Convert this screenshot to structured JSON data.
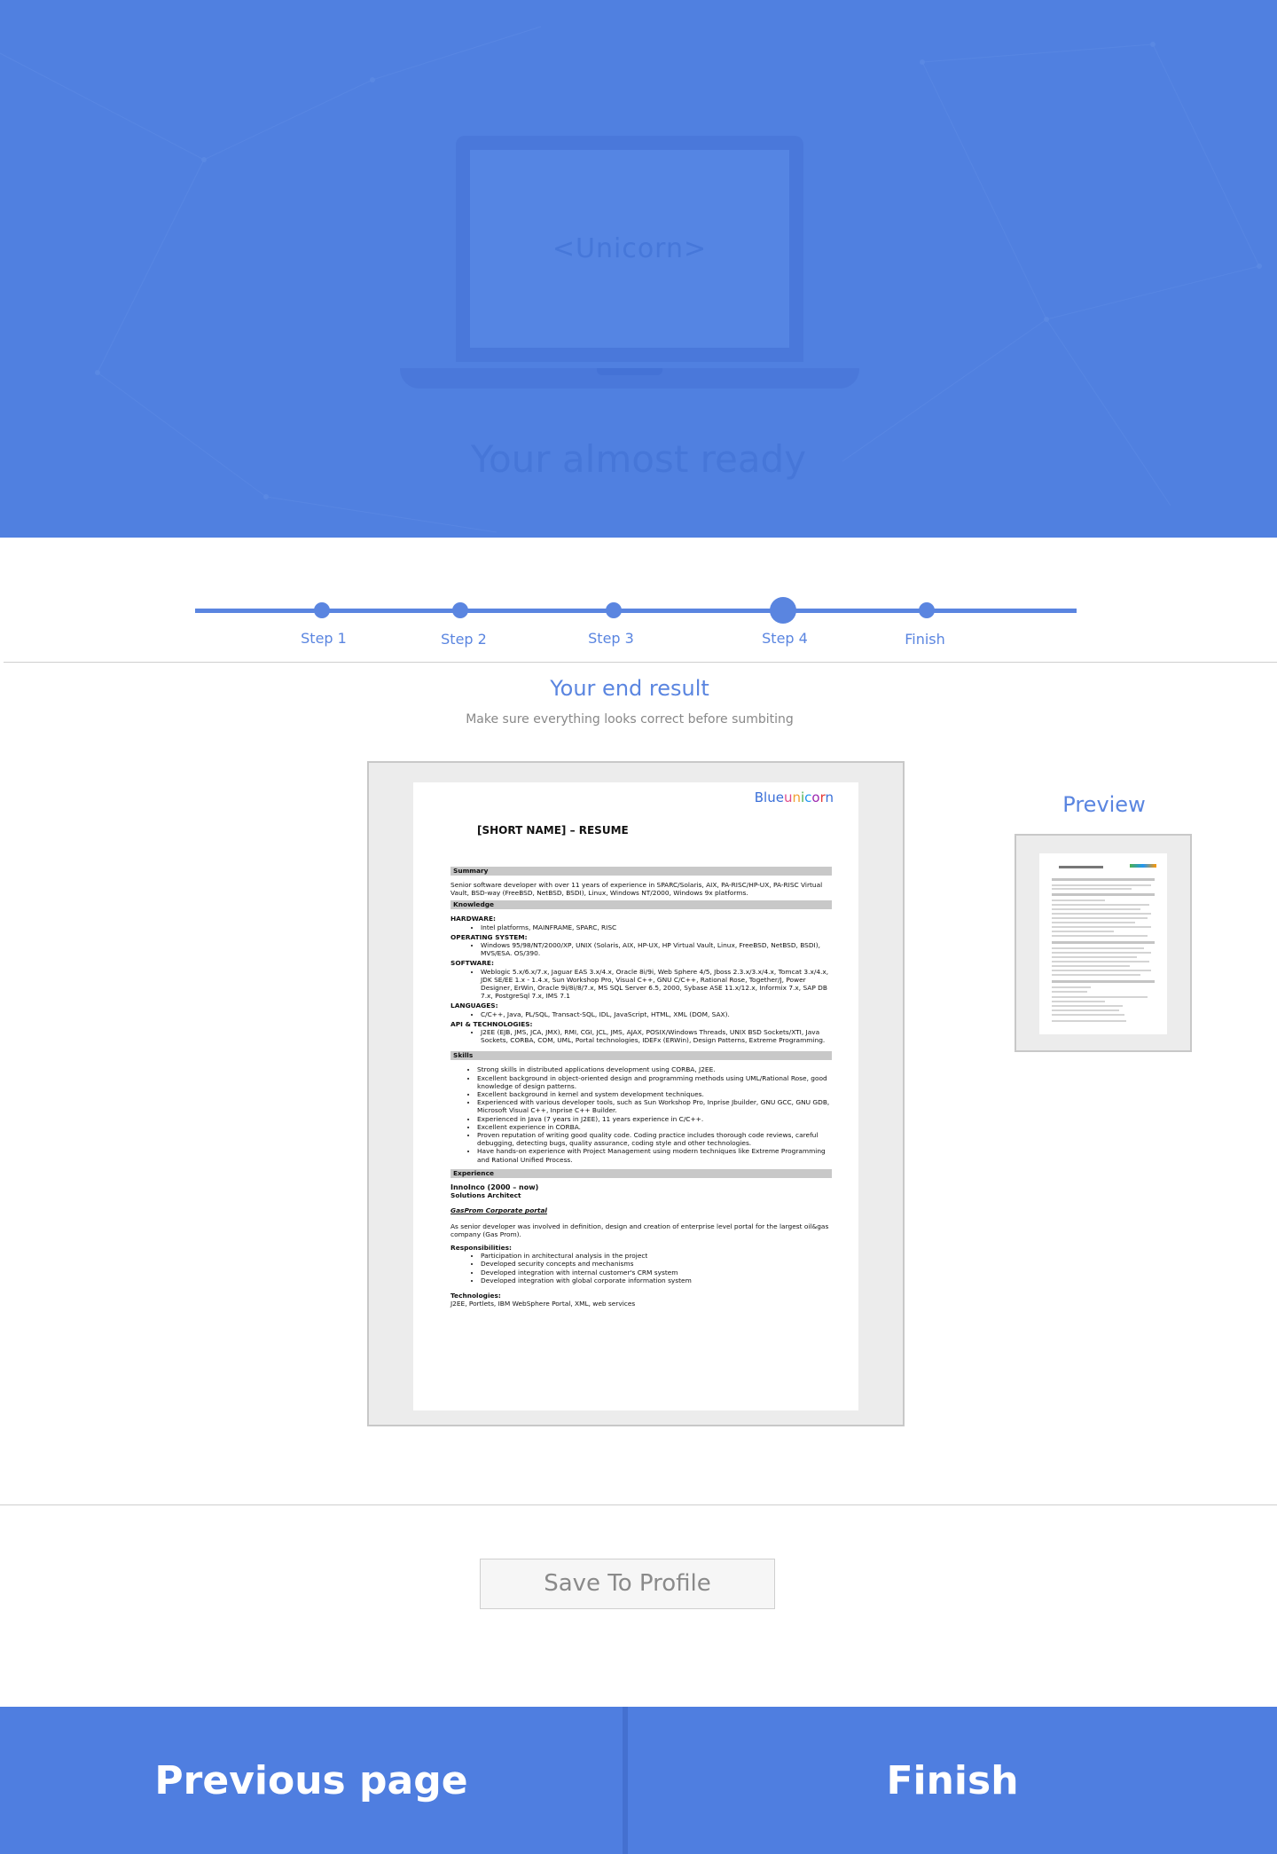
{
  "hero": {
    "screen_text": "<Unicorn>",
    "title": "Your almost ready"
  },
  "stepper": {
    "steps": [
      {
        "label": "Step 1",
        "active": false
      },
      {
        "label": "Step 2",
        "active": false
      },
      {
        "label": "Step 3",
        "active": false
      },
      {
        "label": "Step 4",
        "active": true
      },
      {
        "label": "Finish",
        "active": false
      }
    ]
  },
  "result": {
    "title": "Your end result",
    "subtitle": "Make sure everything looks correct  before  sumbiting"
  },
  "document": {
    "brand": "Blueunicorn",
    "title": "[SHORT NAME] – RESUME",
    "summary_heading": "Summary",
    "summary_text": "Senior software developer with over 11 years of experience in  SPARC/Solaris, AIX, PA-RISC/HP-UX, PA-RISC Virtual Vault, BSD-way (FreeBSD, NetBSD, BSDI), Linux, Windows NT/2000, Windows 9x platforms.",
    "knowledge_heading": "Knowledge",
    "hardware_label": "HARDWARE:",
    "hardware_items": [
      "Intel platforms, MAINFRAME, SPARC, RISC"
    ],
    "os_label": "OPERATING SYSTEM:",
    "os_items": [
      "Windows 95/98/NT/2000/XP, UNIX (Solaris, AIX, HP-UX, HP Virtual Vault, Linux, FreeBSD, NetBSD, BSDI), MVS/ESA. OS/390."
    ],
    "software_label": "SOFTWARE:",
    "software_items": [
      "Weblogic 5.x/6.x/7.x, Jaguar EAS 3.x/4.x, Oracle 8i/9i, Web Sphere 4/5, Jboss 2.3.x/3.x/4.x, Tomcat 3.x/4.x, JDK SE/EE 1.x - 1.4.x, Sun Workshop Pro, Visual C++, GNU C/C++, Rational Rose, Together/J, Power Designer, ErWin, Oracle 9i/8i/8/7.x, MS SQL Server 6.5, 2000, Sybase ASE 11.x/12.x, Informix 7.x, SAP DB 7.x, PostgreSql 7.x, IMS 7.1"
    ],
    "languages_label": "LANGUAGES:",
    "languages_items": [
      "C/C++, Java,  PL/SQL, Transact-SQL, IDL, JavaScript, HTML, XML (DOM, SAX)."
    ],
    "api_label": "API & TECHNOLOGIES:",
    "api_items": [
      "J2EE (EJB, JMS, JCA, JMX), RMI, CGI, JCL, JMS, AJAX, POSIX/Windows Threads, UNIX BSD Sockets/XTI, Java Sockets, CORBA, COM, UML, Portal technologies, IDEFx (ERWin), Design Patterns, Extreme Programming."
    ],
    "skills_heading": "Skills",
    "skills_items": [
      "Strong skills in distributed applications development using CORBA, J2EE.",
      "Excellent background in object-oriented design and programming methods using UML/Rational Rose, good knowledge of design patterns.",
      "Excellent background in kernel and system development techniques.",
      "Experienced with various developer tools, such as Sun Workshop Pro, Inprise Jbuilder, GNU GCC, GNU GDB, Microsoft Visual C++, Inprise C++ Builder.",
      "Experienced in Java (7 years in J2EE), 11 years experience in C/C++.",
      "Excellent experience in CORBA.",
      "Proven reputation of writing good quality code. Coding practice includes thorough code reviews, careful debugging, detecting bugs, quality assurance, coding style and other technologies.",
      "Have hands-on experience with Project Management using modern techniques like Extreme Programming and Rational Unified Process."
    ],
    "experience_heading": "Experience",
    "job_company": "InnoInco (2000 – now)",
    "job_role": "Solutions Architect",
    "project_name": "GasProm Corporate portal",
    "project_desc": "As senior developer was involved in definition, design and creation of enterprise level portal for the largest oil&gas company (Gas Prom).",
    "resp_label": "Responsibilities:",
    "resp_items": [
      "Participation in architectural analysis in the project",
      "Developed security concepts and mechanisms",
      "Developed integration with internal customer's CRM system",
      "Developed integration with global corporate information system"
    ],
    "tech_label": "Technologies:",
    "tech_text": "J2EE, Portlets, IBM WebSphere Portal, XML, web services"
  },
  "preview": {
    "title": "Preview"
  },
  "actions": {
    "save_label": "Save To Profile",
    "prev_label": "Previous page",
    "finish_label": "Finish"
  },
  "colors": {
    "primary": "#5080e0",
    "accent_text": "#5a85e0",
    "divider": "#cfcfcf"
  }
}
